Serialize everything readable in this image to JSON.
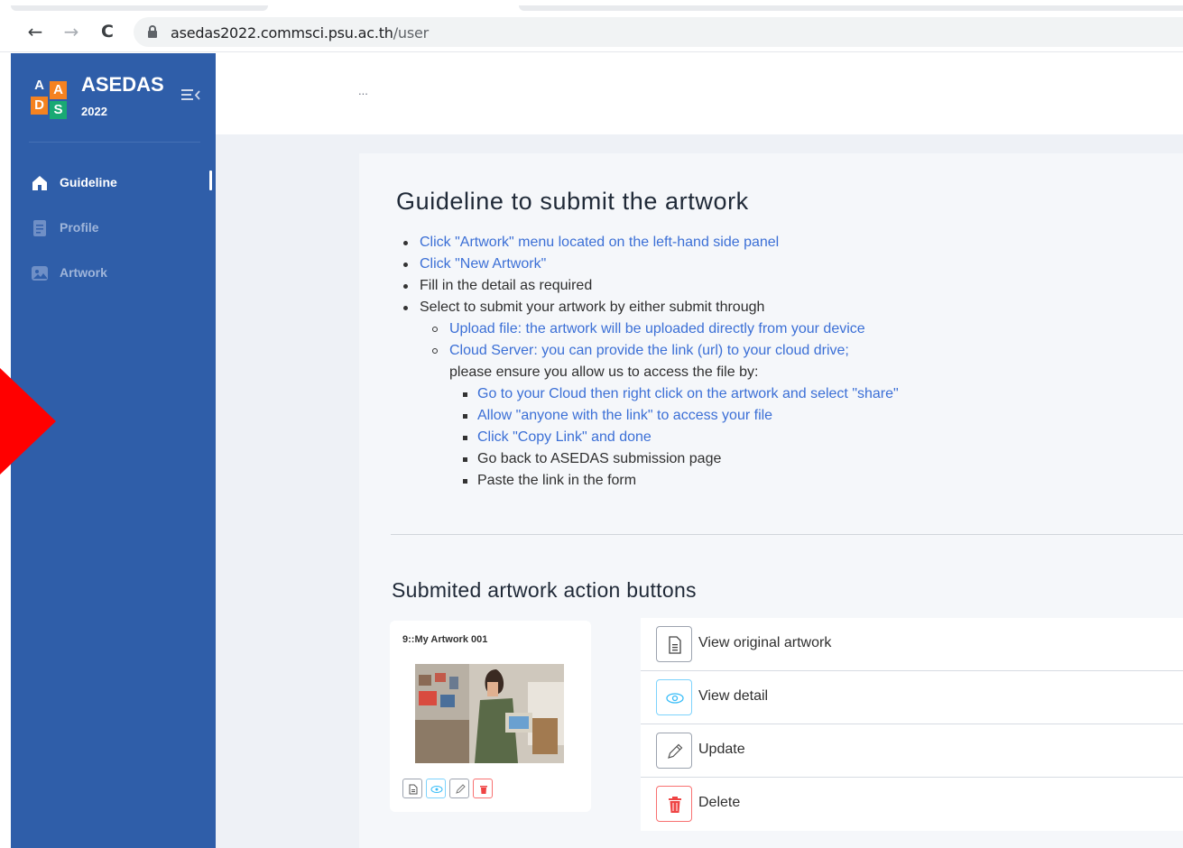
{
  "browser": {
    "url_host": "asedas2022.commsci.psu.ac.th",
    "url_path": "/user",
    "back_icon": "←",
    "forward_icon": "→",
    "reload_icon": "C"
  },
  "sidebar": {
    "logo_letters": [
      "A",
      "A",
      "D",
      "S"
    ],
    "brand_name": "ASEDAS",
    "brand_year": "2022",
    "items": [
      {
        "label": "Guideline",
        "icon": "home-icon",
        "active": true
      },
      {
        "label": "Profile",
        "icon": "document-icon",
        "active": false
      },
      {
        "label": "Artwork",
        "icon": "image-icon",
        "active": false
      }
    ]
  },
  "topbar": {
    "ellipsis": "..."
  },
  "guideline": {
    "title": "Guideline to submit the artwork",
    "lines": [
      "Click \"Artwork\" menu located on the left-hand side panel",
      "Click \"New Artwork\"",
      "Fill in the detail as required",
      "Select to submit your artwork by either submit through",
      "Upload file: the artwork will be uploaded directly from your device",
      "Cloud Server: you can provide the link (url) to your cloud drive;",
      "please ensure you allow us to access the file by:",
      "Go to your Cloud then right click on the artwork and select \"share\"",
      "Allow \"anyone with the link\" to access your file",
      "Click \"Copy Link\" and done",
      "Go back to ASEDAS submission page",
      "Paste the link in the form"
    ]
  },
  "actions_section": {
    "title": "Submited artwork action buttons",
    "artwork_card_title": "9::My Artwork 001",
    "actions": [
      {
        "label": "View original artwork",
        "icon": "file-icon"
      },
      {
        "label": "View detail",
        "icon": "eye-icon"
      },
      {
        "label": "Update",
        "icon": "pencil-icon"
      },
      {
        "label": "Delete",
        "icon": "trash-icon"
      }
    ]
  },
  "colors": {
    "sidebar": "#2f5ea9",
    "link": "#3b6fd6",
    "logo_orange": "#f58220",
    "logo_green": "#19a974",
    "logo_teal": "#1aa0a8",
    "delete_red": "#ef4444",
    "view_cyan": "#38bdf8",
    "annotation_arrow": "#ff0000"
  }
}
